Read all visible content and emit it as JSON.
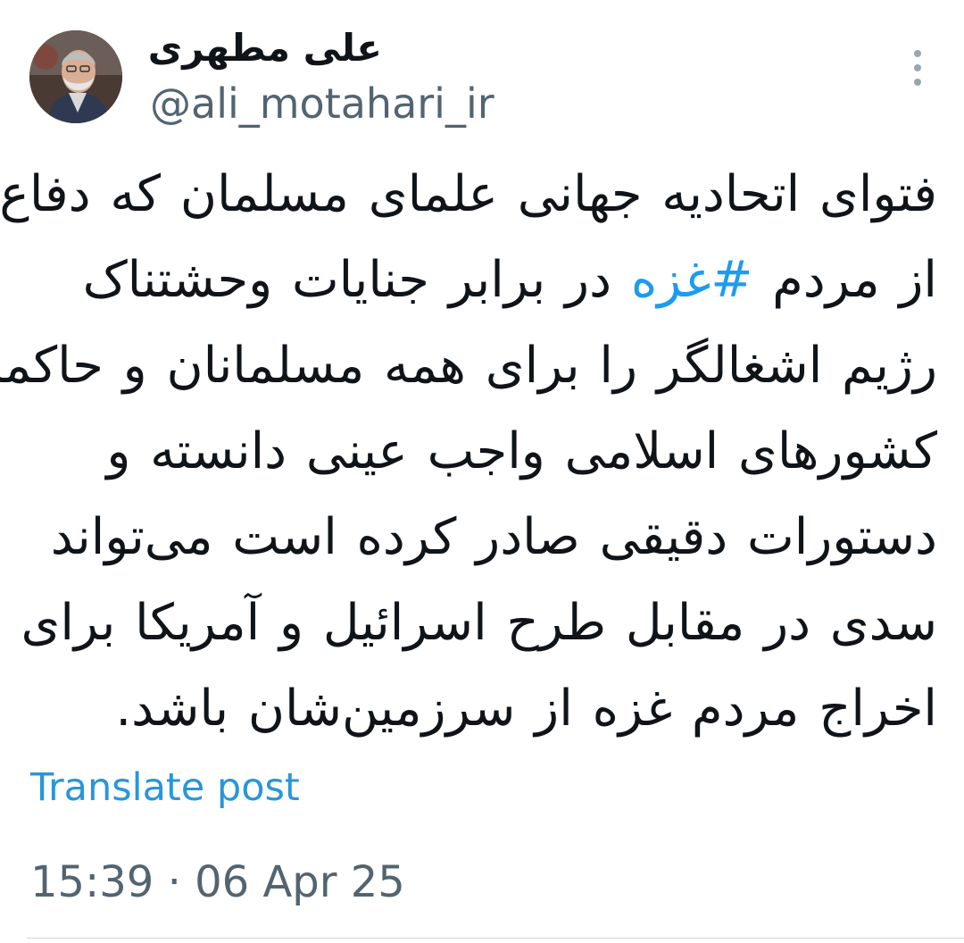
{
  "author": {
    "display_name": "علی مطهری",
    "handle": "@ali_motahari_ir",
    "avatar_icon": "profile-photo"
  },
  "menu": {
    "icon": "more-vertical-icon"
  },
  "tweet": {
    "lines": [
      {
        "text": "فتوای اتحادیه جهانی علمای مسلمان که دفاع"
      },
      {
        "before": "از مردم ",
        "hashtag": "#غزه",
        "after": " در برابر جنایات وحشتناک"
      },
      {
        "text": "رژیم اشغالگر را برای همه مسلمانان و حاکمان"
      },
      {
        "text": "کشورهای اسلامی واجب عینی دانسته و"
      },
      {
        "text": "دستورات دقیقی صادر کرده است می‌تواند"
      },
      {
        "text": "سدی در مقابل طرح اسرائیل و آمریکا برای"
      },
      {
        "text": "اخراج مردم غزه از سرزمین‌شان باشد."
      }
    ],
    "hashtag_color": "#1d9bf0"
  },
  "translate_label": "Translate post",
  "timestamp": "15:39 · 06 Apr 25",
  "colors": {
    "text": "#0f1419",
    "secondary": "#536471",
    "link": "#2796da"
  }
}
